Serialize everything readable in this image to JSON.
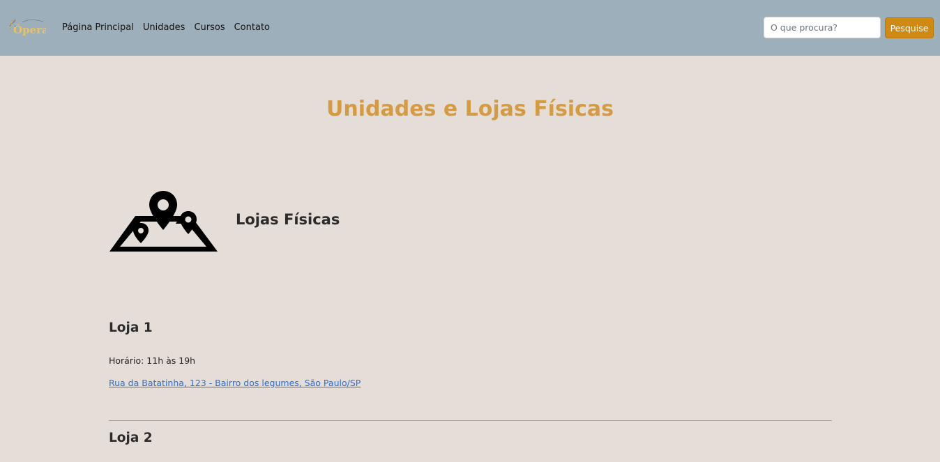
{
  "navbar": {
    "brand_text": "Ópera",
    "links": [
      "Página Principal",
      "Unidades",
      "Cursos",
      "Contato"
    ],
    "search_placeholder": "O que procura?",
    "search_button_label": "Pesquise"
  },
  "main": {
    "page_title": "Unidades e Lojas Físicas",
    "section_icon": "map-pins-icon",
    "section_heading": "Lojas Físicas",
    "stores": [
      {
        "title": "Loja 1",
        "hours": "Horário: 11h às 19h",
        "address": "Rua da Batatinha, 123 - Bairro dos legumes, São Paulo/SP"
      },
      {
        "title": "Loja 2"
      }
    ]
  },
  "colors": {
    "navbar_bg": "#9dafbb",
    "page_bg": "#e5ddd8",
    "title_accent": "#d59b42",
    "button_bg": "#d08a12",
    "link": "#2c6fd1"
  }
}
